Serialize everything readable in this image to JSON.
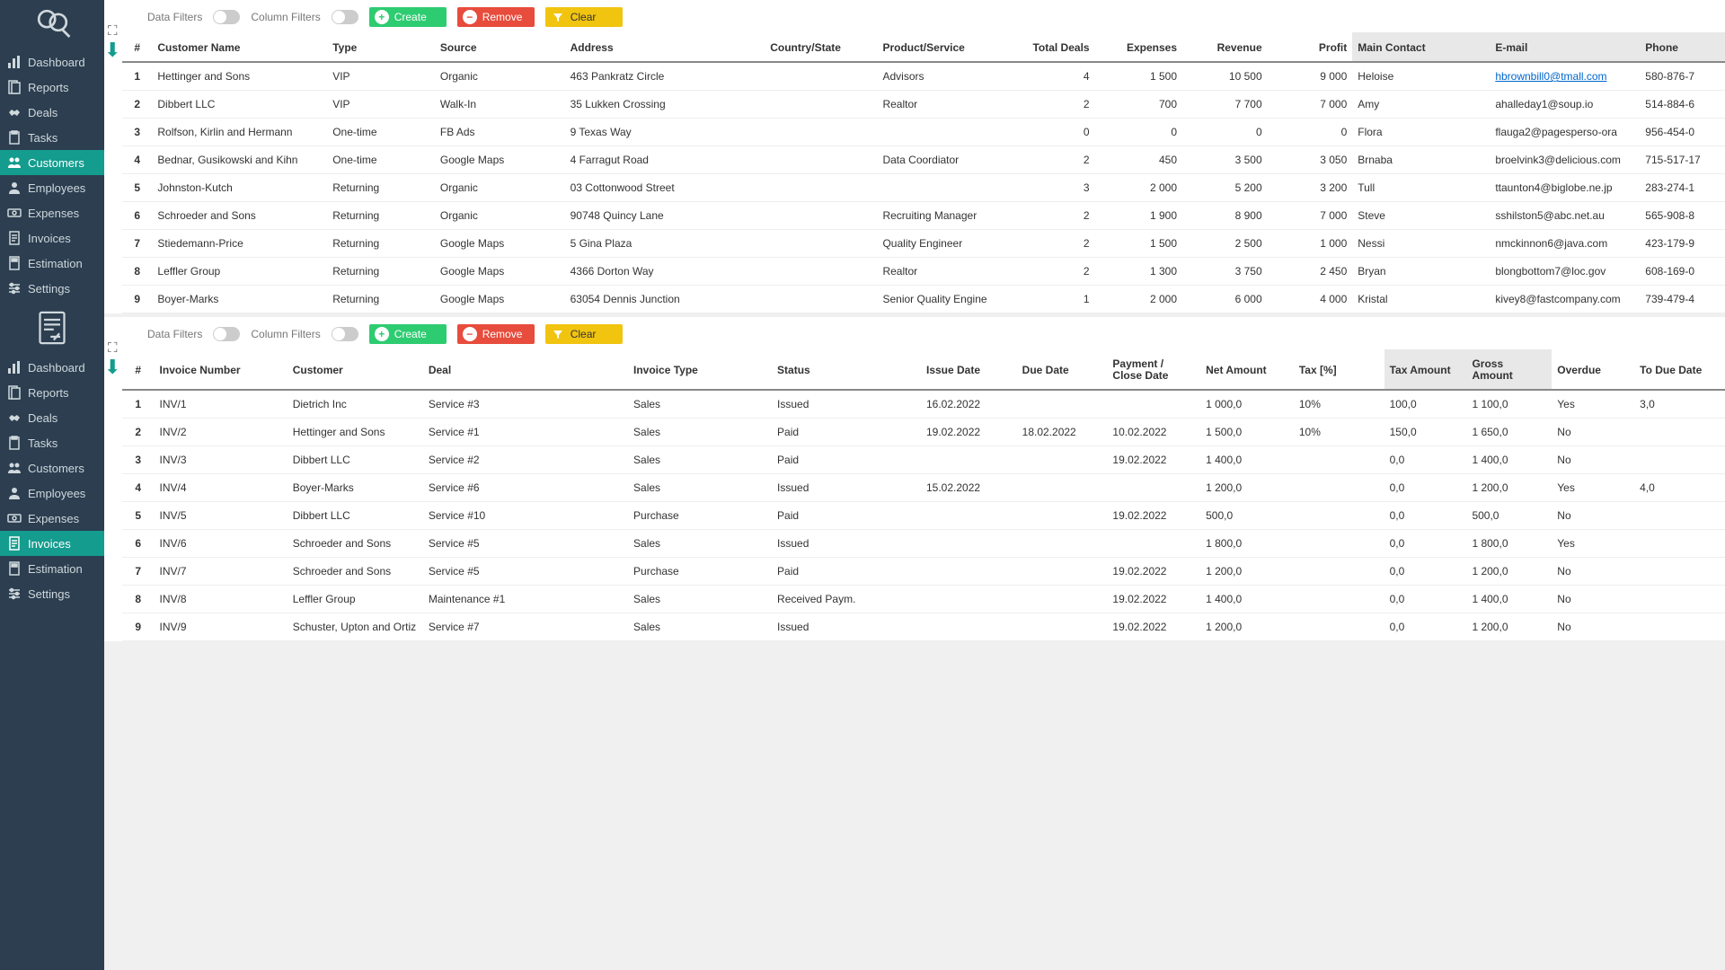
{
  "sidebar1": {
    "items": [
      {
        "label": "Dashboard",
        "icon": "chart"
      },
      {
        "label": "Reports",
        "icon": "report"
      },
      {
        "label": "Deals",
        "icon": "handshake"
      },
      {
        "label": "Tasks",
        "icon": "clipboard"
      },
      {
        "label": "Customers",
        "icon": "users",
        "active": true
      },
      {
        "label": "Employees",
        "icon": "user"
      },
      {
        "label": "Expenses",
        "icon": "money"
      },
      {
        "label": "Invoices",
        "icon": "invoice"
      },
      {
        "label": "Estimation",
        "icon": "calc"
      },
      {
        "label": "Settings",
        "icon": "sliders"
      }
    ]
  },
  "sidebar2": {
    "items": [
      {
        "label": "Dashboard",
        "icon": "chart"
      },
      {
        "label": "Reports",
        "icon": "report"
      },
      {
        "label": "Deals",
        "icon": "handshake"
      },
      {
        "label": "Tasks",
        "icon": "clipboard"
      },
      {
        "label": "Customers",
        "icon": "users"
      },
      {
        "label": "Employees",
        "icon": "user"
      },
      {
        "label": "Expenses",
        "icon": "money"
      },
      {
        "label": "Invoices",
        "icon": "invoice",
        "active": true
      },
      {
        "label": "Estimation",
        "icon": "calc"
      },
      {
        "label": "Settings",
        "icon": "sliders"
      }
    ]
  },
  "toolbar": {
    "data_filters": "Data Filters",
    "column_filters": "Column Filters",
    "create": "Create",
    "remove": "Remove",
    "clear": "Clear"
  },
  "customers": {
    "columns": [
      "#",
      "Customer Name",
      "Type",
      "Source",
      "Address",
      "Country/State",
      "Product/Service",
      "Total Deals",
      "Expenses",
      "Revenue",
      "Profit",
      "Main Contact",
      "E-mail",
      "Phone"
    ],
    "rows": [
      {
        "n": "1",
        "name": "Hettinger and Sons",
        "type": "VIP",
        "source": "Organic",
        "address": "463 Pankratz Circle",
        "country": "",
        "product": "Advisors",
        "deals": "4",
        "exp": "1 500",
        "rev": "10 500",
        "profit": "9 000",
        "contact": "Heloise",
        "email": "hbrownbill0@tmall.com",
        "email_link": true,
        "phone": "580-876-7"
      },
      {
        "n": "2",
        "name": "Dibbert LLC",
        "type": "VIP",
        "source": "Walk-In",
        "address": "35 Lukken Crossing",
        "country": "",
        "product": "Realtor",
        "deals": "2",
        "exp": "700",
        "rev": "7 700",
        "profit": "7 000",
        "contact": "Amy",
        "email": "ahalleday1@soup.io",
        "phone": "514-884-6"
      },
      {
        "n": "3",
        "name": "Rolfson, Kirlin and Hermann",
        "type": "One-time",
        "source": "FB Ads",
        "address": "9 Texas Way",
        "country": "",
        "product": "",
        "deals": "0",
        "exp": "0",
        "rev": "0",
        "profit": "0",
        "contact": "Flora",
        "email": "flauga2@pagesperso-ora",
        "phone": "956-454-0"
      },
      {
        "n": "4",
        "name": "Bednar, Gusikowski and Kihn",
        "type": "One-time",
        "source": "Google Maps",
        "address": "4 Farragut Road",
        "country": "",
        "product": "Data Coordiator",
        "deals": "2",
        "exp": "450",
        "rev": "3 500",
        "profit": "3 050",
        "contact": "Brnaba",
        "email": "broelvink3@delicious.com",
        "phone": "715-517-17"
      },
      {
        "n": "5",
        "name": "Johnston-Kutch",
        "type": "Returning",
        "source": "Organic",
        "address": "03 Cottonwood Street",
        "country": "",
        "product": "",
        "deals": "3",
        "exp": "2 000",
        "rev": "5 200",
        "profit": "3 200",
        "contact": "Tull",
        "email": "ttaunton4@biglobe.ne.jp",
        "phone": "283-274-1"
      },
      {
        "n": "6",
        "name": "Schroeder and Sons",
        "type": "Returning",
        "source": "Organic",
        "address": "90748 Quincy Lane",
        "country": "",
        "product": "Recruiting Manager",
        "deals": "2",
        "exp": "1 900",
        "rev": "8 900",
        "profit": "7 000",
        "contact": "Steve",
        "email": "sshilston5@abc.net.au",
        "phone": "565-908-8"
      },
      {
        "n": "7",
        "name": "Stiedemann-Price",
        "type": "Returning",
        "source": "Google Maps",
        "address": "5 Gina Plaza",
        "country": "",
        "product": "Quality Engineer",
        "deals": "2",
        "exp": "1 500",
        "rev": "2 500",
        "profit": "1 000",
        "contact": "Nessi",
        "email": "nmckinnon6@java.com",
        "phone": "423-179-9"
      },
      {
        "n": "8",
        "name": "Leffler Group",
        "type": "Returning",
        "source": "Google Maps",
        "address": "4366 Dorton Way",
        "country": "",
        "product": "Realtor",
        "deals": "2",
        "exp": "1 300",
        "rev": "3 750",
        "profit": "2 450",
        "contact": "Bryan",
        "email": "blongbottom7@loc.gov",
        "phone": "608-169-0"
      },
      {
        "n": "9",
        "name": "Boyer-Marks",
        "type": "Returning",
        "source": "Google Maps",
        "address": "63054 Dennis Junction",
        "country": "",
        "product": "Senior Quality Engine",
        "deals": "1",
        "exp": "2 000",
        "rev": "6 000",
        "profit": "4 000",
        "contact": "Kristal",
        "email": "kivey8@fastcompany.com",
        "phone": "739-479-4"
      }
    ]
  },
  "invoices": {
    "columns": [
      "#",
      "Invoice Number",
      "Customer",
      "Deal",
      "Invoice Type",
      "Status",
      "Issue Date",
      "Due Date",
      "Payment / Close Date",
      "Net Amount",
      "Tax [%]",
      "Tax Amount",
      "Gross Amount",
      "Overdue",
      "To Due Date"
    ],
    "rows": [
      {
        "n": "1",
        "inv": "INV/1",
        "cust": "Dietrich Inc",
        "deal": "Service #3",
        "type": "Sales",
        "status": "Issued",
        "issue": "16.02.2022",
        "due": "",
        "pay": "",
        "net": "1 000,0",
        "taxp": "10%",
        "taxa": "100,0",
        "gross": "1 100,0",
        "over": "Yes",
        "todue": "3,0"
      },
      {
        "n": "2",
        "inv": "INV/2",
        "cust": "Hettinger and Sons",
        "deal": "Service #1",
        "type": "Sales",
        "status": "Paid",
        "issue": "19.02.2022",
        "due": "18.02.2022",
        "pay": "10.02.2022",
        "net": "1 500,0",
        "taxp": "10%",
        "taxa": "150,0",
        "gross": "1 650,0",
        "over": "No",
        "todue": ""
      },
      {
        "n": "3",
        "inv": "INV/3",
        "cust": "Dibbert LLC",
        "deal": "Service #2",
        "type": "Sales",
        "status": "Paid",
        "issue": "",
        "due": "",
        "pay": "19.02.2022",
        "net": "1 400,0",
        "taxp": "",
        "taxa": "0,0",
        "gross": "1 400,0",
        "over": "No",
        "todue": ""
      },
      {
        "n": "4",
        "inv": "INV/4",
        "cust": "Boyer-Marks",
        "deal": "Service #6",
        "type": "Sales",
        "status": "Issued",
        "issue": "15.02.2022",
        "due": "",
        "pay": "",
        "net": "1 200,0",
        "taxp": "",
        "taxa": "0,0",
        "gross": "1 200,0",
        "over": "Yes",
        "todue": "4,0"
      },
      {
        "n": "5",
        "inv": "INV/5",
        "cust": "Dibbert LLC",
        "deal": "Service #10",
        "type": "Purchase",
        "status": "Paid",
        "issue": "",
        "due": "",
        "pay": "19.02.2022",
        "net": "500,0",
        "taxp": "",
        "taxa": "0,0",
        "gross": "500,0",
        "over": "No",
        "todue": ""
      },
      {
        "n": "6",
        "inv": "INV/6",
        "cust": "Schroeder and Sons",
        "deal": "Service #5",
        "type": "Sales",
        "status": "Issued",
        "issue": "",
        "due": "",
        "pay": "",
        "net": "1 800,0",
        "taxp": "",
        "taxa": "0,0",
        "gross": "1 800,0",
        "over": "Yes",
        "todue": ""
      },
      {
        "n": "7",
        "inv": "INV/7",
        "cust": "Schroeder and Sons",
        "deal": "Service #5",
        "type": "Purchase",
        "status": "Paid",
        "issue": "",
        "due": "",
        "pay": "19.02.2022",
        "net": "1 200,0",
        "taxp": "",
        "taxa": "0,0",
        "gross": "1 200,0",
        "over": "No",
        "todue": ""
      },
      {
        "n": "8",
        "inv": "INV/8",
        "cust": "Leffler Group",
        "deal": "Maintenance #1",
        "type": "Sales",
        "status": "Received Paym.",
        "issue": "",
        "due": "",
        "pay": "19.02.2022",
        "net": "1 400,0",
        "taxp": "",
        "taxa": "0,0",
        "gross": "1 400,0",
        "over": "No",
        "todue": ""
      },
      {
        "n": "9",
        "inv": "INV/9",
        "cust": "Schuster, Upton and Ortiz",
        "deal": "Service #7",
        "type": "Sales",
        "status": "Issued",
        "issue": "",
        "due": "",
        "pay": "19.02.2022",
        "net": "1 200,0",
        "taxp": "",
        "taxa": "0,0",
        "gross": "1 200,0",
        "over": "No",
        "todue": ""
      }
    ]
  }
}
